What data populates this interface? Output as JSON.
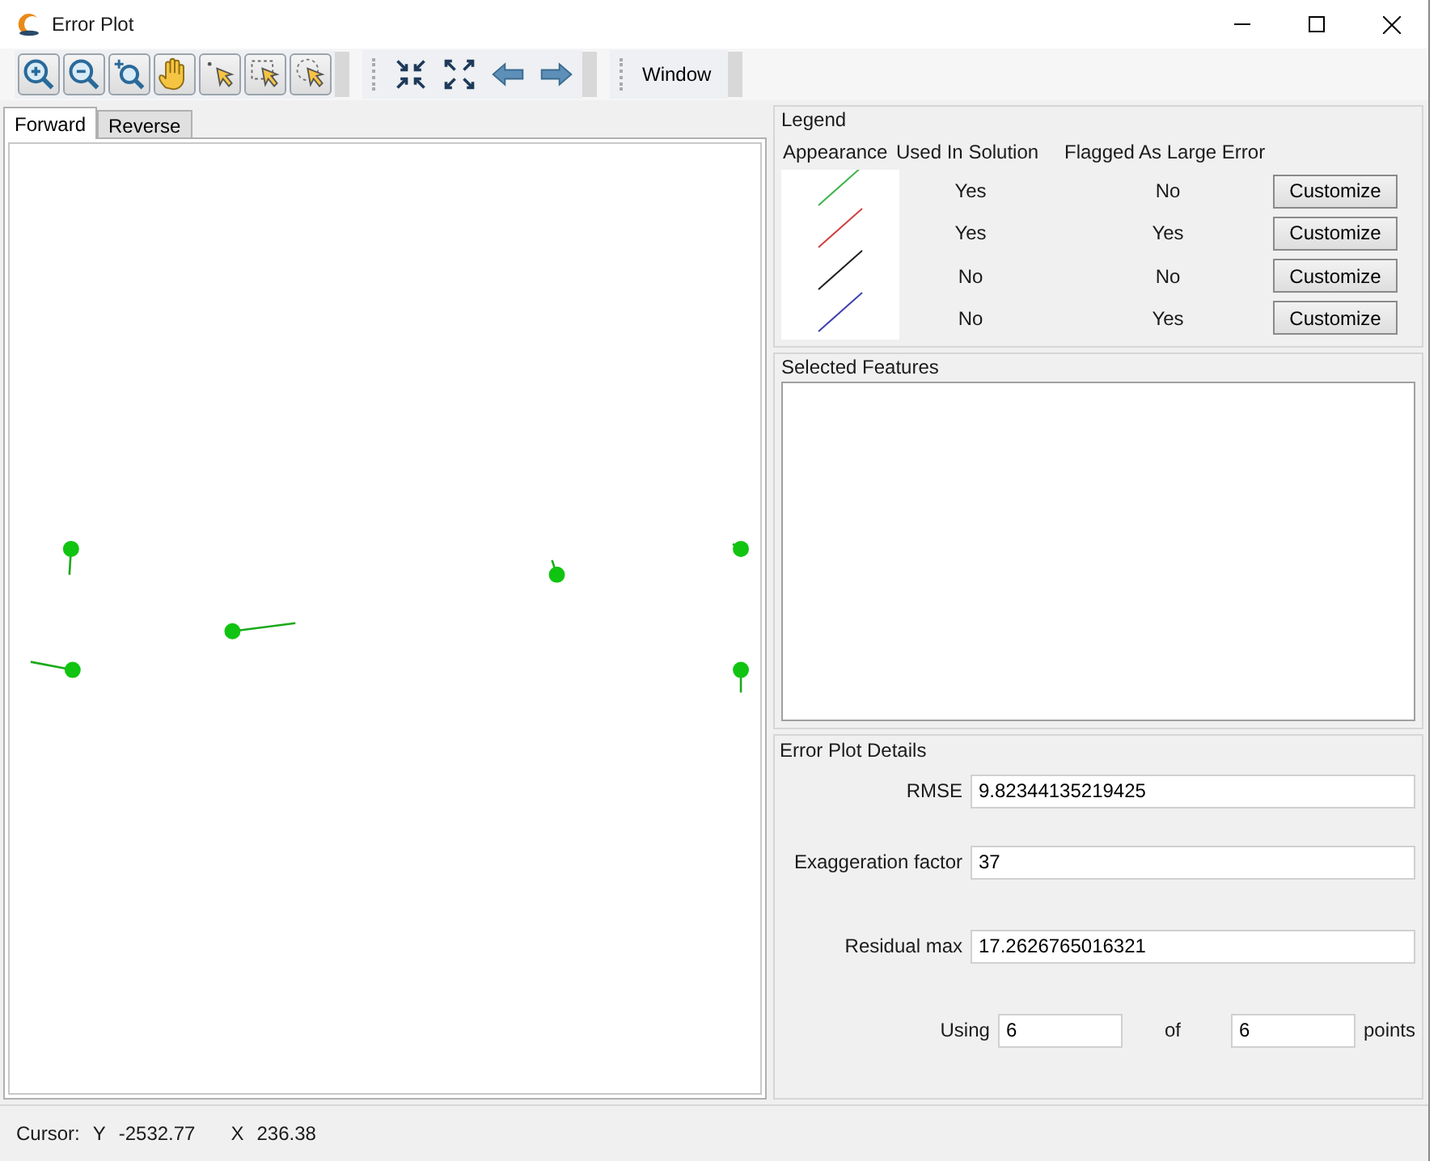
{
  "window": {
    "title": "Error Plot"
  },
  "toolbar": {
    "window_menu": "Window"
  },
  "tabs": [
    {
      "label": "Forward",
      "selected": true
    },
    {
      "label": "Reverse",
      "selected": false
    }
  ],
  "legend": {
    "title": "Legend",
    "columns": [
      "Appearance",
      "Used In Solution",
      "Flagged As Large Error"
    ],
    "rows": [
      {
        "color": "#3cb44b",
        "used": "Yes",
        "flagged": "No",
        "button": "Customize"
      },
      {
        "color": "#d04040",
        "used": "Yes",
        "flagged": "Yes",
        "button": "Customize"
      },
      {
        "color": "#202020",
        "used": "No",
        "flagged": "No",
        "button": "Customize"
      },
      {
        "color": "#4040b0",
        "used": "No",
        "flagged": "Yes",
        "button": "Customize"
      }
    ]
  },
  "selected_features": {
    "title": "Selected Features"
  },
  "details": {
    "title": "Error Plot Details",
    "fields": [
      {
        "label": "RMSE",
        "value": "9.82344135219425"
      },
      {
        "label": "Exaggeration factor",
        "value": "37"
      },
      {
        "label": "Residual max",
        "value": "17.2626765016321"
      }
    ],
    "using": {
      "label": "Using",
      "value": "6",
      "of_label": "of",
      "total": "6",
      "unit": "points"
    }
  },
  "status_bar": {
    "cursor_label": "Cursor:",
    "y_label": "Y",
    "y_value": "-2532.77",
    "x_label": "X",
    "x_value": "236.38"
  }
}
